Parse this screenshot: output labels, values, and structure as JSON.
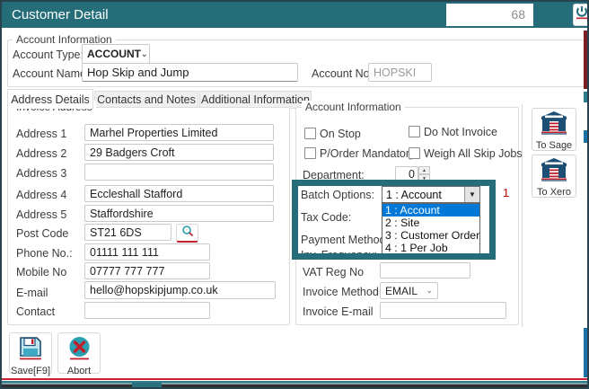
{
  "window": {
    "title": "Customer Detail",
    "counter": "68"
  },
  "account_info_top": {
    "section_title": "Account Information",
    "account_type_label": "Account Type:",
    "account_type_value": "ACCOUNT",
    "account_name_label": "Account Name:",
    "account_name_value": "Hop Skip and Jump",
    "account_no_label": "Account No.",
    "account_no_value": "HOPSKI"
  },
  "tabs": [
    {
      "label": "Address Details"
    },
    {
      "label": "Contacts and Notes"
    },
    {
      "label": "Additional Information"
    }
  ],
  "invoice_address": {
    "section_title": "Invoice Address",
    "fields": [
      {
        "label": "Address 1",
        "value": "Marhel Properties Limited"
      },
      {
        "label": "Address 2",
        "value": "29 Badgers Croft"
      },
      {
        "label": "Address 3",
        "value": ""
      },
      {
        "label": "Address 4",
        "value": "Eccleshall Stafford"
      },
      {
        "label": "Address 5",
        "value": "Staffordshire"
      },
      {
        "label": "Post Code",
        "value": "ST21 6DS"
      },
      {
        "label": "Phone No.:",
        "value": "01111 111 111"
      },
      {
        "label": "Mobile No",
        "value": "07777 777 777"
      },
      {
        "label": "E-mail",
        "value": "hello@hopskipjump.co.uk"
      },
      {
        "label": "Contact",
        "value": ""
      }
    ]
  },
  "account_information": {
    "section_title": "Account Information",
    "checkboxes": [
      {
        "label": "On Stop",
        "checked": false
      },
      {
        "label": "Do Not Invoice",
        "checked": false
      },
      {
        "label": "P/Order Mandatory",
        "checked": false
      },
      {
        "label": "Weigh All Skip Jobs",
        "checked": false
      }
    ],
    "department_label": "Department:",
    "department_value": "0",
    "batch_options_label": "Batch Options:",
    "batch_options_value": "1 : Account",
    "tax_code_label": "Tax Code:",
    "payment_method_label": "Payment Method:",
    "clipped_label": "Inv. Frequency:",
    "dropdown_options": [
      "1 : Account",
      "2 : Site",
      "3 : Customer Order",
      "4 : 1 Per Job"
    ],
    "selected_option": "1 : Account",
    "badge_value": "1",
    "vat_label": "VAT Reg No",
    "vat_value": "",
    "invoice_method_label": "Invoice Method",
    "invoice_method_value": "EMAIL",
    "invoice_email_label": "Invoice E-mail",
    "invoice_email_value": ""
  },
  "side_buttons": [
    {
      "label": "To Sage"
    },
    {
      "label": "To Xero"
    }
  ],
  "footer_buttons": [
    {
      "label": "Save[F9]"
    },
    {
      "label": "Abort"
    }
  ],
  "colors": {
    "titlebar": "#256d78",
    "overlay_border": "#256d78",
    "selection_blue": "#0078d7",
    "accent_red": "#c0202c",
    "icon_navy": "#1d4e74",
    "icon_teal": "#2a9fb0"
  }
}
